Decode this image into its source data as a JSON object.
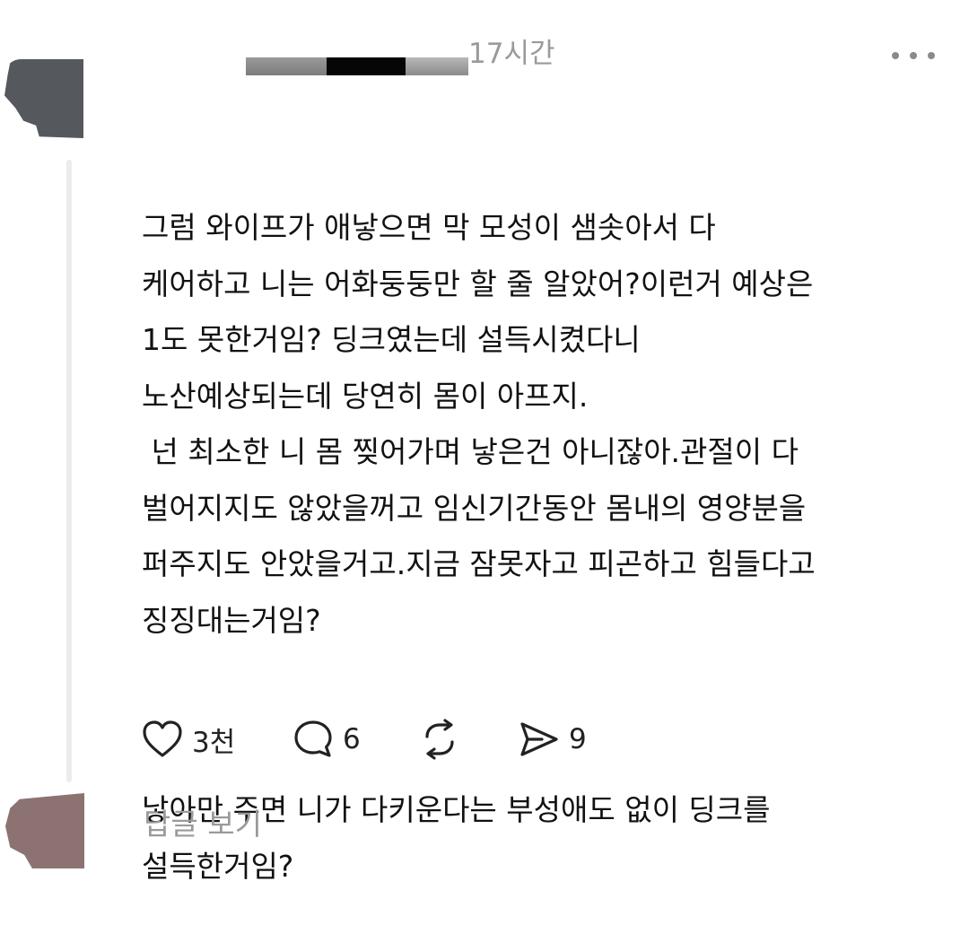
{
  "post": {
    "timestamp": "17시간",
    "paragraphs": [
      "그럼 와이프가 애낳으면 막 모성이 샘솟아서 다\n케어하고 니는 어화둥둥만 할 줄 알았어?이런거 예상은\n1도 못한거임? 딩크였는데 설득시켰다니\n노산예상되는데 당연히 몸이 아프지.\n 넌 최소한 니 몸 찢어가며 낳은건 아니잖아.관절이 다\n벌어지지도 않았을꺼고 임신기간동안 몸내의 영양분을\n퍼주지도 안았을거고.지금 잠못자고 피곤하고 힘들다고\n징징대는거임?",
      "낳아만 주면 니가 다키운다는 부성애도 없이 딩크를\n설득한거임?"
    ]
  },
  "actions": {
    "like_count": "3천",
    "comment_count": "6",
    "repost_count": "",
    "share_count": "9"
  },
  "replies": {
    "view_label": "답글 보기"
  },
  "colors": {
    "muted_text": "#9a9a9a",
    "icon": "#222222",
    "thread_line": "#ececec"
  },
  "icons": {
    "like": "heart-icon",
    "comment": "comment-bubble-icon",
    "repost": "repost-icon",
    "share": "send-icon",
    "menu": "more-horizontal-icon"
  }
}
